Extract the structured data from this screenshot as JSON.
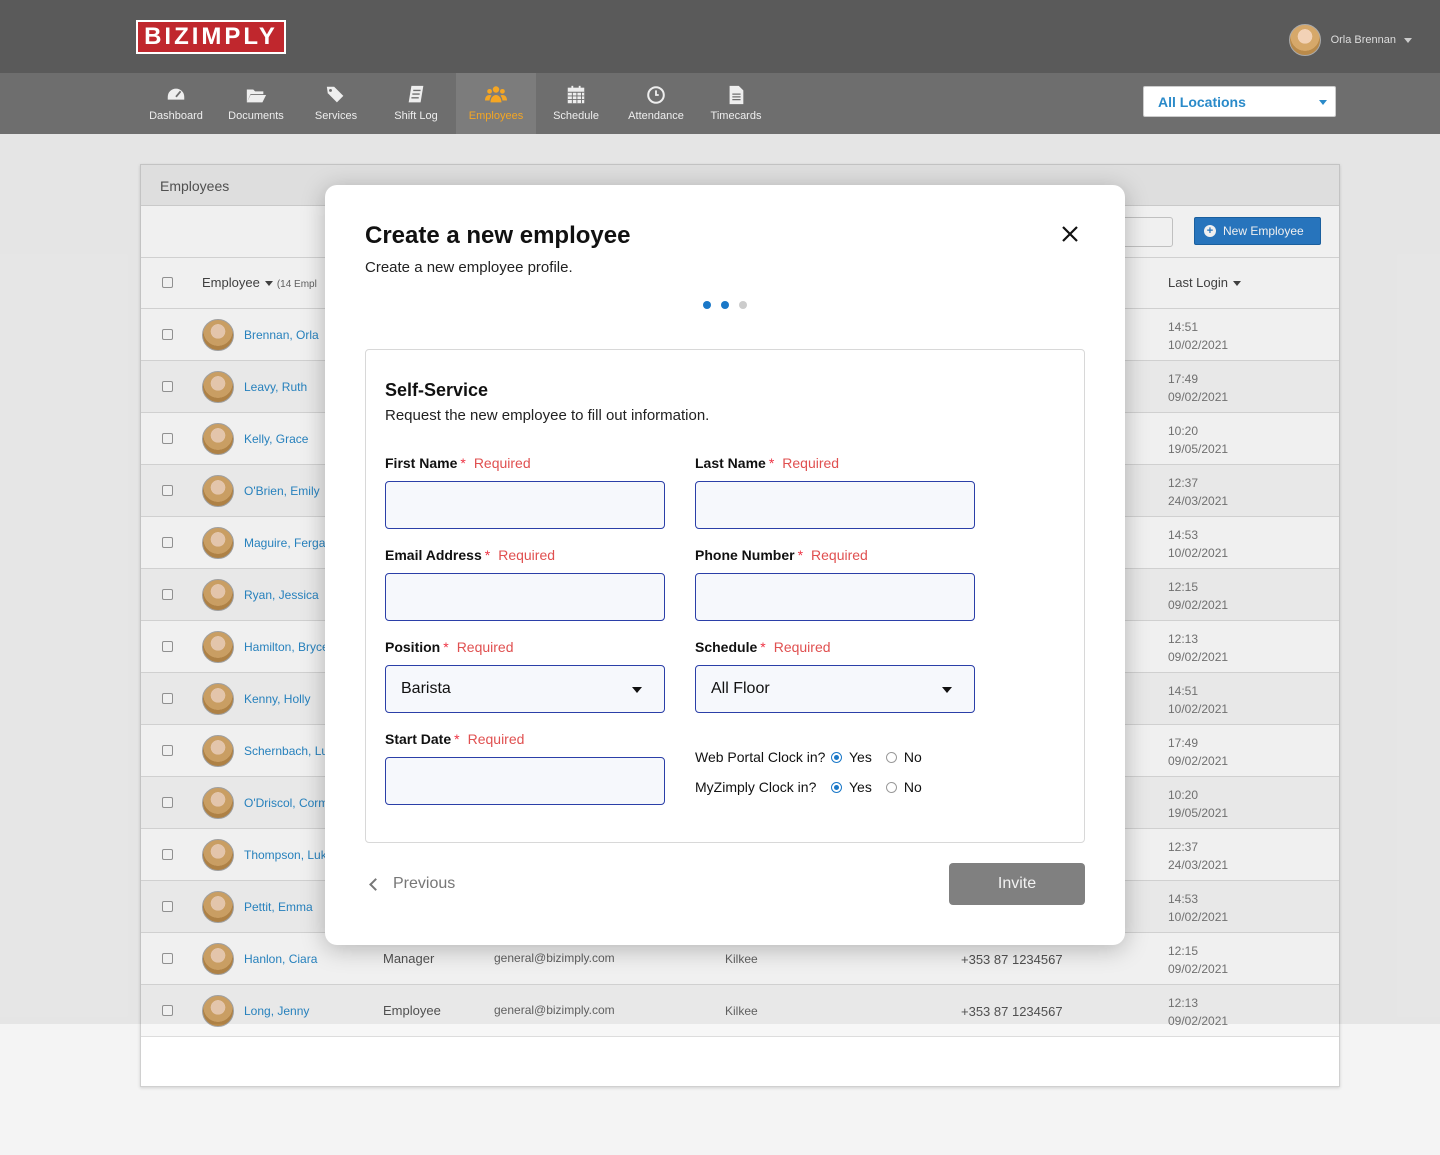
{
  "header": {
    "logo": "BIZIMPLY",
    "user_name": "Orla Brennan"
  },
  "nav": {
    "items": [
      {
        "label": "Dashboard",
        "icon": "dashboard-icon"
      },
      {
        "label": "Documents",
        "icon": "folder-icon"
      },
      {
        "label": "Services",
        "icon": "tags-icon"
      },
      {
        "label": "Shift Log",
        "icon": "notebook-icon"
      },
      {
        "label": "Employees",
        "icon": "users-icon",
        "active": true
      },
      {
        "label": "Schedule",
        "icon": "calendar-icon"
      },
      {
        "label": "Attendance",
        "icon": "clock-icon"
      },
      {
        "label": "Timecards",
        "icon": "file-icon"
      }
    ],
    "location": "All Locations"
  },
  "list": {
    "title": "Employees",
    "new_button": "New Employee",
    "col_employee": "Employee",
    "col_employee_count": "(14 Empl",
    "col_last_login": "Last Login",
    "rows": [
      {
        "name": "Brennan, Orla",
        "position": "",
        "email": "",
        "location": "",
        "phone": "",
        "time": "14:51",
        "date": "10/02/2021"
      },
      {
        "name": "Leavy, Ruth",
        "position": "",
        "email": "",
        "location": "",
        "phone": "",
        "time": "17:49",
        "date": "09/02/2021"
      },
      {
        "name": "Kelly, Grace",
        "position": "",
        "email": "",
        "location": "",
        "phone": "",
        "time": "10:20",
        "date": "19/05/2021"
      },
      {
        "name": "O'Brien, Emily",
        "position": "",
        "email": "",
        "location": "",
        "phone": "",
        "time": "12:37",
        "date": "24/03/2021"
      },
      {
        "name": "Maguire, Fergal",
        "position": "",
        "email": "",
        "location": "",
        "phone": "",
        "time": "14:53",
        "date": "10/02/2021"
      },
      {
        "name": "Ryan, Jessica",
        "position": "",
        "email": "",
        "location": "",
        "phone": "",
        "time": "12:15",
        "date": "09/02/2021"
      },
      {
        "name": "Hamilton, Bryce",
        "position": "",
        "email": "",
        "location": "",
        "phone": "",
        "time": "12:13",
        "date": "09/02/2021"
      },
      {
        "name": "Kenny, Holly",
        "position": "",
        "email": "",
        "location": "",
        "phone": "",
        "time": "14:51",
        "date": "10/02/2021"
      },
      {
        "name": "Schernbach, Lu",
        "position": "",
        "email": "",
        "location": "",
        "phone": "",
        "time": "17:49",
        "date": "09/02/2021"
      },
      {
        "name": "O'Driscol, Corm",
        "position": "",
        "email": "",
        "location": "",
        "phone": "",
        "time": "10:20",
        "date": "19/05/2021"
      },
      {
        "name": "Thompson, Luk",
        "position": "",
        "email": "",
        "location": "",
        "phone": "",
        "time": "12:37",
        "date": "24/03/2021"
      },
      {
        "name": "Pettit, Emma",
        "position": "",
        "email": "",
        "location": "",
        "phone": "",
        "time": "14:53",
        "date": "10/02/2021"
      },
      {
        "name": "Hanlon, Ciara",
        "position": "Manager",
        "email": "general@bizimply.com",
        "location": "Kilkee",
        "phone": "+353 87 1234567",
        "time": "12:15",
        "date": "09/02/2021"
      },
      {
        "name": "Long, Jenny",
        "position": "Employee",
        "email": "general@bizimply.com",
        "location": "Kilkee",
        "phone": "+353 87 1234567",
        "time": "12:13",
        "date": "09/02/2021"
      }
    ]
  },
  "modal": {
    "title": "Create a new employee",
    "subtitle": "Create a new employee profile.",
    "steps_total": 3,
    "steps_done": 2,
    "section_title": "Self-Service",
    "section_sub": "Request the new employee to fill out information.",
    "required_text": "Required",
    "required_mark": "*",
    "fields": {
      "first_name": {
        "label": "First Name",
        "value": ""
      },
      "last_name": {
        "label": "Last Name",
        "value": ""
      },
      "email": {
        "label": "Email Address",
        "value": ""
      },
      "phone": {
        "label": "Phone Number",
        "value": ""
      },
      "position": {
        "label": "Position",
        "value": "Barista"
      },
      "schedule": {
        "label": "Schedule",
        "value": "All Floor"
      },
      "start_date": {
        "label": "Start Date",
        "value": ""
      }
    },
    "web_clock": {
      "question": "Web Portal Clock in?",
      "yes": "Yes",
      "no": "No",
      "selected": "Yes"
    },
    "my_clock": {
      "question": "MyZimply Clock in?",
      "yes": "Yes",
      "no": "No",
      "selected": "Yes"
    },
    "previous": "Previous",
    "invite": "Invite"
  }
}
